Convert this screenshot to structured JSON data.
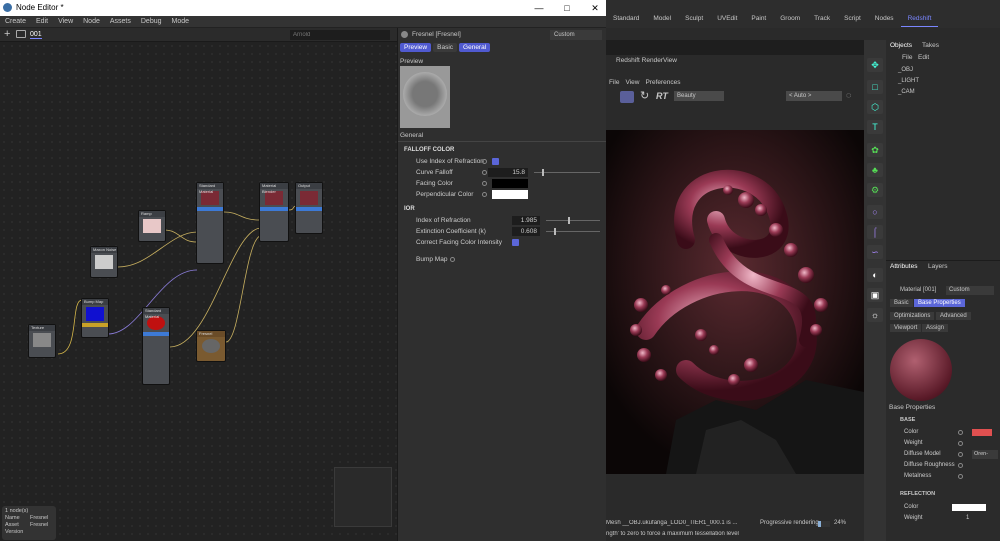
{
  "node_editor": {
    "title": "Node Editor *",
    "menu": [
      "Create",
      "Edit",
      "View",
      "Node",
      "Assets",
      "Debug",
      "Mode"
    ],
    "tab": "001",
    "search_placeholder": "Arnold",
    "info": {
      "l1": "1 node(s)",
      "name_l": "Name",
      "name_v": "Fresnel",
      "asset_l": "Asset",
      "asset_v": "Fresnel",
      "version_l": "Version"
    }
  },
  "panel": {
    "header": "Fresnel [Fresnel]",
    "preset": "Custom",
    "tabs": [
      "Preview",
      "Basic",
      "General"
    ],
    "preview_label": "Preview",
    "general_label": "General",
    "falloff_section": "FALLOFF COLOR",
    "use_ior": "Use Index of Refraction",
    "curve_falloff": "Curve Falloff",
    "curve_val": "15.8",
    "facing": "Facing Color",
    "perp": "Perpendicular Color",
    "ior_section": "IOR",
    "ior": "Index of Refraction",
    "ior_val": "1.985",
    "ext": "Extinction Coefficient (k)",
    "ext_val": "0.608",
    "correct": "Correct Facing Color Intensity",
    "bump": "Bump Map"
  },
  "nodes": [
    {
      "label": "Texture"
    },
    {
      "label": "Bump Map"
    },
    {
      "label": "Maxon Noise"
    },
    {
      "label": "Ramp"
    },
    {
      "label": "Standard Material"
    },
    {
      "label": "Fresnel"
    },
    {
      "label": "Standard Material"
    },
    {
      "label": "Material Blender"
    },
    {
      "label": "Output"
    }
  ],
  "app_menu": [
    "Standard",
    "Model",
    "Sculpt",
    "UVEdit",
    "Paint",
    "Groom",
    "Track",
    "Script",
    "Nodes",
    "Redshift"
  ],
  "render_view": {
    "title": "Redshift RenderView",
    "menu": [
      "File",
      "View",
      "Preferences"
    ],
    "aov": "Beauty",
    "zoom": "< Auto >",
    "status": "Mesh __OBJ.ukufanga_LOD0_TIER1_000.1 is ...",
    "status2": "ngth' to zero to force a maximum tessellation level",
    "progress_label": "Progressive rendering",
    "progress": 24,
    "progress_text": "24%"
  },
  "objects": {
    "tabs": [
      "Objects",
      "Takes"
    ],
    "menu": [
      "File",
      "Edit"
    ],
    "items": [
      "_OBJ",
      "_LIGHT",
      "_CAM"
    ]
  },
  "attributes": {
    "tabs": [
      "Attributes",
      "Layers"
    ],
    "mode": "Material [001]",
    "preset": "Custom",
    "btns": [
      "Basic",
      "Base Properties",
      "Optimizations",
      "Advanced",
      "Viewport",
      "Assign"
    ],
    "heading": "Base Properties",
    "base": "BASE",
    "props": [
      "Color",
      "Weight",
      "Diffuse Model",
      "Diffuse Roughness",
      "Metalness"
    ],
    "diffuse_val": "Oren-",
    "refl": "REFLECTION",
    "refl_props": [
      "Color",
      "Weight"
    ],
    "refl_weight": "1"
  },
  "colors": {
    "accent": "#5b66d8",
    "red_swatch": "#e05050"
  }
}
